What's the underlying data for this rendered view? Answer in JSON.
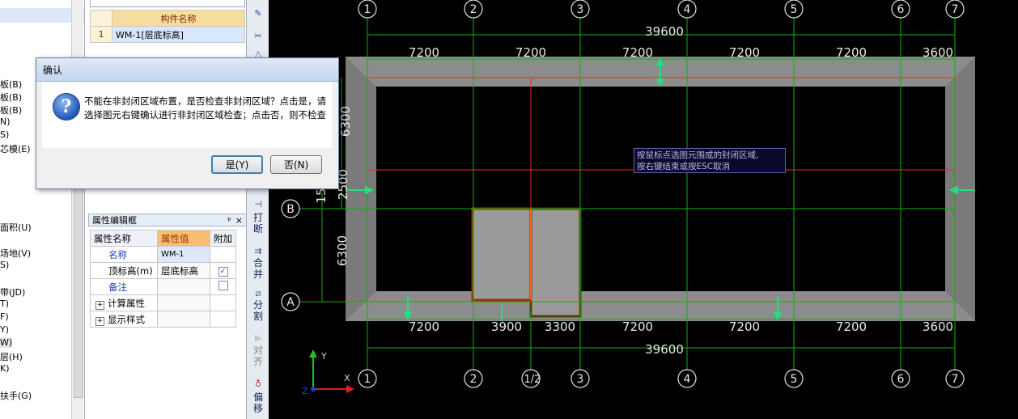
{
  "left_tree": {
    "items": [
      "板(B)",
      "板(B)",
      "板(B)",
      "N)",
      "S)",
      "芯模(E)",
      "面积(U)",
      "场地(V)",
      "S)",
      "带(JD)",
      "T)",
      "F)",
      "Y)",
      "W)",
      "层(H)",
      "K)",
      "扶手(G)"
    ]
  },
  "component_list": {
    "header": "构件名称",
    "rows": [
      {
        "index": "1",
        "name": "WM-1[层底标高]"
      }
    ]
  },
  "property_panel": {
    "title": "属性编辑框",
    "pin": "ᵖ",
    "close": "×",
    "columns": [
      "属性名称",
      "属性值",
      "附加"
    ],
    "rows": [
      {
        "name": "名称",
        "value": "WM-1",
        "checked": null
      },
      {
        "name": "顶标高(m)",
        "value": "层底标高",
        "checked": true
      },
      {
        "name": "备注",
        "value": "",
        "checked": false
      },
      {
        "name": "计算属性",
        "value": "",
        "expand": "+"
      },
      {
        "name": "显示样式",
        "value": "",
        "expand": "+"
      }
    ]
  },
  "vertical_toolbar": {
    "buttons": [
      "打断",
      "合并",
      "分割",
      "对齐",
      "偏移"
    ]
  },
  "dialog": {
    "title": "确认",
    "message": "不能在非封闭区域布置，是否检查非封闭区域？点击是，请选择图元右键确认进行非封闭区域检查；点击否，则不检查",
    "yes_label": "是(Y)",
    "no_label": "否(N)"
  },
  "canvas": {
    "top_axis_labels": [
      "1",
      "2",
      "3",
      "4",
      "5",
      "6",
      "7"
    ],
    "bottom_axis_labels": [
      "1",
      "2",
      "1/2",
      "3",
      "4",
      "5",
      "6",
      "7"
    ],
    "row_axis_labels": [
      "B",
      "A"
    ],
    "top_total_dim": "39600",
    "top_dims": [
      "7200",
      "7200",
      "7200",
      "7200",
      "7200",
      "3600"
    ],
    "bottom_dims": [
      "7200",
      "3900",
      "3300",
      "7200",
      "7200",
      "7200",
      "3600"
    ],
    "bottom_total_dim": "39600",
    "left_dims": [
      "6300",
      "2500",
      "15",
      "6300"
    ],
    "tooltip_line1": "按鼠标点选图元围成的封闭区域,",
    "tooltip_line2": "按右键结束或按ESC取消",
    "ucs_labels": [
      "Y",
      "X",
      "Z"
    ],
    "colors": {
      "background": "#000000",
      "axis": "#00c000",
      "red_lines": "#ff0000",
      "slab": "#8c8c8c",
      "highlight": "#8b3a00"
    }
  }
}
